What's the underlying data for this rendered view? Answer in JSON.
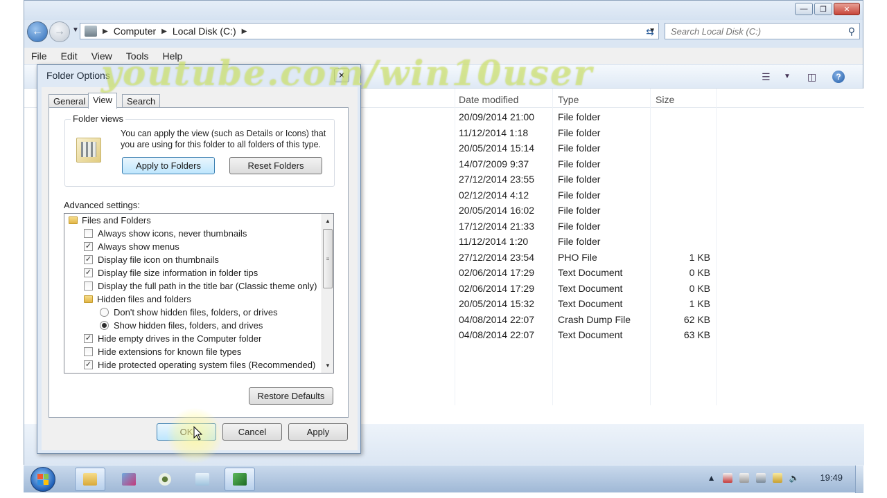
{
  "explorer": {
    "breadcrumb": [
      "Computer",
      "Local Disk (C:)"
    ],
    "search_placeholder": "Search Local Disk (C:)",
    "menu": [
      "File",
      "Edit",
      "View",
      "Tools",
      "Help"
    ],
    "columns": [
      "Date modified",
      "Type",
      "Size"
    ],
    "rows": [
      {
        "date": "20/09/2014 21:00",
        "type": "File folder",
        "size": ""
      },
      {
        "date": "11/12/2014 1:18",
        "type": "File folder",
        "size": ""
      },
      {
        "date": "20/05/2014 15:14",
        "type": "File folder",
        "size": ""
      },
      {
        "date": "14/07/2009 9:37",
        "type": "File folder",
        "size": ""
      },
      {
        "date": "27/12/2014 23:55",
        "type": "File folder",
        "size": ""
      },
      {
        "date": "02/12/2014 4:12",
        "type": "File folder",
        "size": ""
      },
      {
        "date": "20/05/2014 16:02",
        "type": "File folder",
        "size": ""
      },
      {
        "date": "17/12/2014 21:33",
        "type": "File folder",
        "size": ""
      },
      {
        "date": "11/12/2014 1:20",
        "type": "File folder",
        "size": ""
      },
      {
        "date": "27/12/2014 23:54",
        "type": "PHO File",
        "size": "1 KB"
      },
      {
        "date": "02/06/2014 17:29",
        "type": "Text Document",
        "size": "0 KB"
      },
      {
        "date": "02/06/2014 17:29",
        "type": "Text Document",
        "size": "0 KB"
      },
      {
        "date": "20/05/2014 15:32",
        "type": "Text Document",
        "size": "1 KB"
      },
      {
        "date": "04/08/2014 22:07",
        "type": "Crash Dump File",
        "size": "62 KB"
      },
      {
        "date": "04/08/2014 22:07",
        "type": "Text Document",
        "size": "63 KB"
      }
    ]
  },
  "watermark": "youtube.com/win10user",
  "dialog": {
    "title": "Folder Options",
    "tabs": [
      "General",
      "View",
      "Search"
    ],
    "active_tab": "View",
    "folder_views": {
      "label": "Folder views",
      "description": "You can apply the view (such as Details or Icons) that you are using for this folder to all folders of this type.",
      "apply_button": "Apply to Folders",
      "reset_button": "Reset Folders"
    },
    "advanced_label": "Advanced settings:",
    "advanced_items": [
      {
        "kind": "folder",
        "indent": 0,
        "label": "Files and Folders"
      },
      {
        "kind": "checkbox",
        "indent": 1,
        "label": "Always show icons, never thumbnails",
        "checked": false
      },
      {
        "kind": "checkbox",
        "indent": 1,
        "label": "Always show menus",
        "checked": true
      },
      {
        "kind": "checkbox",
        "indent": 1,
        "label": "Display file icon on thumbnails",
        "checked": true
      },
      {
        "kind": "checkbox",
        "indent": 1,
        "label": "Display file size information in folder tips",
        "checked": true
      },
      {
        "kind": "checkbox",
        "indent": 1,
        "label": "Display the full path in the title bar (Classic theme only)",
        "checked": false
      },
      {
        "kind": "folder",
        "indent": 1,
        "label": "Hidden files and folders"
      },
      {
        "kind": "radio",
        "indent": 2,
        "label": "Don't show hidden files, folders, or drives",
        "checked": false
      },
      {
        "kind": "radio",
        "indent": 2,
        "label": "Show hidden files, folders, and drives",
        "checked": true
      },
      {
        "kind": "checkbox",
        "indent": 1,
        "label": "Hide empty drives in the Computer folder",
        "checked": true
      },
      {
        "kind": "checkbox",
        "indent": 1,
        "label": "Hide extensions for known file types",
        "checked": false
      },
      {
        "kind": "checkbox",
        "indent": 1,
        "label": "Hide protected operating system files (Recommended)",
        "checked": true
      }
    ],
    "restore_button": "Restore Defaults",
    "ok_button": "OK",
    "cancel_button": "Cancel",
    "apply_button": "Apply"
  },
  "taskbar": {
    "clock": "19:49"
  },
  "colors": {
    "accent": "#3c7fb1",
    "watermark": "#d7eb78"
  }
}
